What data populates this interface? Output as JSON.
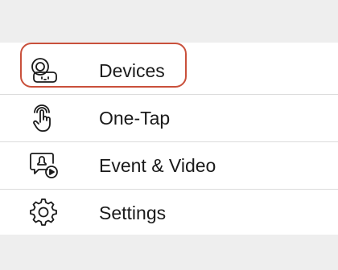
{
  "menu": {
    "items": [
      {
        "label": "Devices",
        "icon": "camera-plug-icon",
        "highlighted": true
      },
      {
        "label": "One-Tap",
        "icon": "tap-hand-icon",
        "highlighted": false
      },
      {
        "label": "Event & Video",
        "icon": "event-video-icon",
        "highlighted": false
      },
      {
        "label": "Settings",
        "icon": "gear-icon",
        "highlighted": false
      }
    ]
  },
  "colors": {
    "highlight": "#c9503b",
    "band": "#eeeeee",
    "text": "#1a1a1a",
    "divider": "#dcdcdc"
  }
}
